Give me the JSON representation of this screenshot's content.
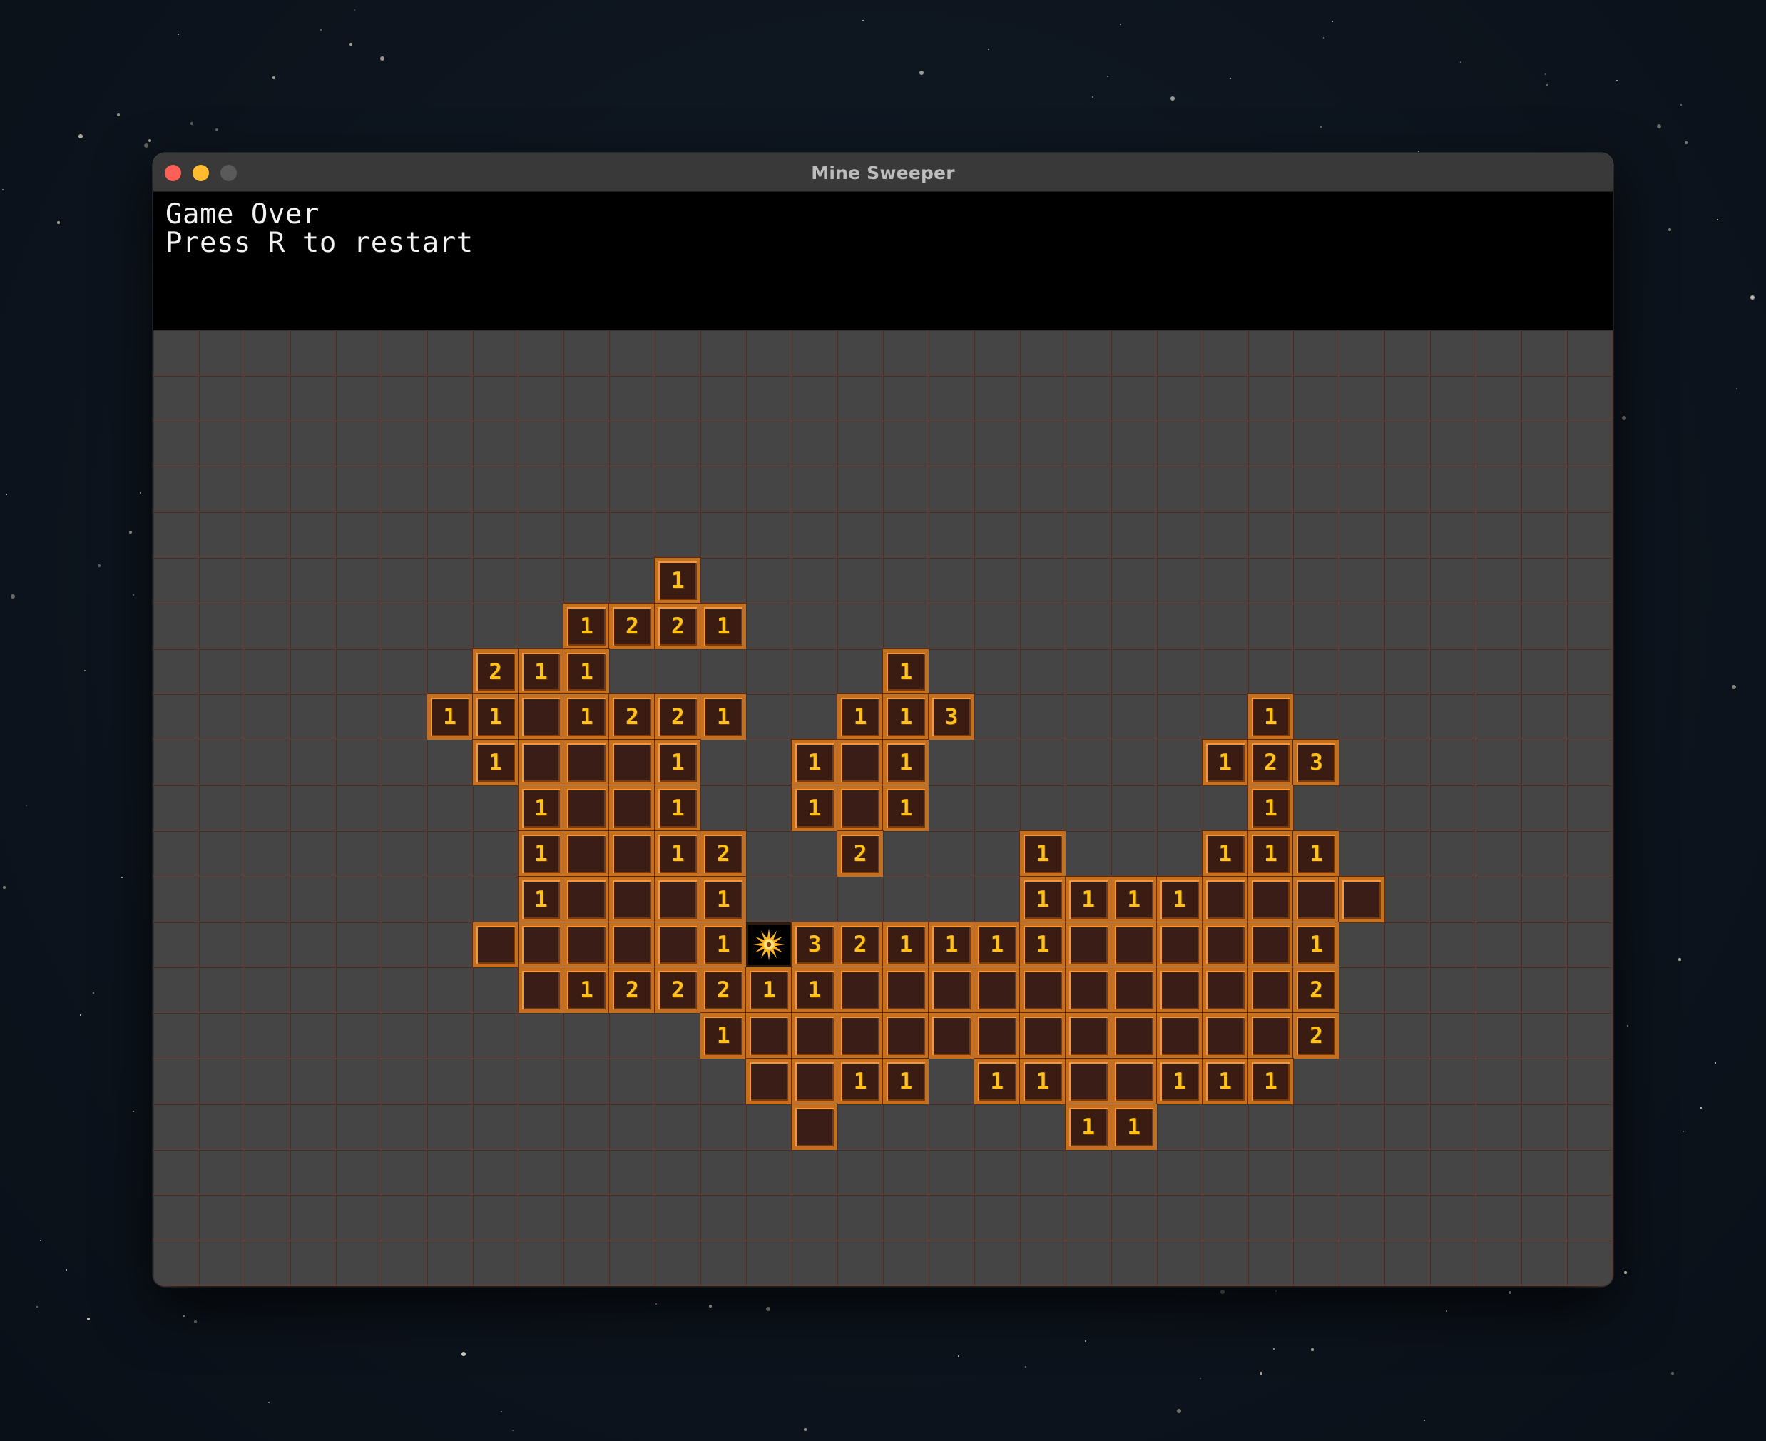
{
  "window": {
    "title": "Mine Sweeper"
  },
  "hud": {
    "line1": "Game Over",
    "line2": "Press R to restart"
  },
  "board": {
    "cols": 32,
    "rows": 21,
    "revealed": [
      {
        "r": 5,
        "c": 11,
        "n": 1
      },
      {
        "r": 6,
        "c": 9,
        "n": 1
      },
      {
        "r": 6,
        "c": 10,
        "n": 2
      },
      {
        "r": 6,
        "c": 11,
        "n": 2
      },
      {
        "r": 6,
        "c": 12,
        "n": 1
      },
      {
        "r": 7,
        "c": 7,
        "n": 2
      },
      {
        "r": 7,
        "c": 8,
        "n": 1
      },
      {
        "r": 7,
        "c": 9,
        "n": 1
      },
      {
        "r": 7,
        "c": 16,
        "n": 1
      },
      {
        "r": 8,
        "c": 6,
        "n": 1
      },
      {
        "r": 8,
        "c": 7,
        "n": 1
      },
      {
        "r": 8,
        "c": 8,
        "n": 0
      },
      {
        "r": 8,
        "c": 9,
        "n": 1
      },
      {
        "r": 8,
        "c": 10,
        "n": 2
      },
      {
        "r": 8,
        "c": 11,
        "n": 2
      },
      {
        "r": 8,
        "c": 12,
        "n": 1
      },
      {
        "r": 8,
        "c": 15,
        "n": 1
      },
      {
        "r": 8,
        "c": 16,
        "n": 1
      },
      {
        "r": 8,
        "c": 17,
        "n": 3
      },
      {
        "r": 8,
        "c": 24,
        "n": 1
      },
      {
        "r": 9,
        "c": 7,
        "n": 1
      },
      {
        "r": 9,
        "c": 8,
        "n": 0
      },
      {
        "r": 9,
        "c": 9,
        "n": 0
      },
      {
        "r": 9,
        "c": 10,
        "n": 0
      },
      {
        "r": 9,
        "c": 11,
        "n": 1
      },
      {
        "r": 9,
        "c": 14,
        "n": 1
      },
      {
        "r": 9,
        "c": 15,
        "n": 0
      },
      {
        "r": 9,
        "c": 16,
        "n": 1
      },
      {
        "r": 9,
        "c": 23,
        "n": 1
      },
      {
        "r": 9,
        "c": 24,
        "n": 2
      },
      {
        "r": 9,
        "c": 25,
        "n": 3
      },
      {
        "r": 10,
        "c": 8,
        "n": 1
      },
      {
        "r": 10,
        "c": 9,
        "n": 0
      },
      {
        "r": 10,
        "c": 10,
        "n": 0
      },
      {
        "r": 10,
        "c": 11,
        "n": 1
      },
      {
        "r": 10,
        "c": 14,
        "n": 1
      },
      {
        "r": 10,
        "c": 15,
        "n": 0
      },
      {
        "r": 10,
        "c": 16,
        "n": 1
      },
      {
        "r": 10,
        "c": 24,
        "n": 1
      },
      {
        "r": 11,
        "c": 8,
        "n": 1
      },
      {
        "r": 11,
        "c": 9,
        "n": 0
      },
      {
        "r": 11,
        "c": 10,
        "n": 0
      },
      {
        "r": 11,
        "c": 11,
        "n": 1
      },
      {
        "r": 11,
        "c": 12,
        "n": 2
      },
      {
        "r": 11,
        "c": 15,
        "n": 2
      },
      {
        "r": 11,
        "c": 19,
        "n": 1
      },
      {
        "r": 11,
        "c": 23,
        "n": 1
      },
      {
        "r": 11,
        "c": 24,
        "n": 1
      },
      {
        "r": 11,
        "c": 25,
        "n": 1
      },
      {
        "r": 12,
        "c": 8,
        "n": 1
      },
      {
        "r": 12,
        "c": 9,
        "n": 0
      },
      {
        "r": 12,
        "c": 10,
        "n": 0
      },
      {
        "r": 12,
        "c": 11,
        "n": 0
      },
      {
        "r": 12,
        "c": 12,
        "n": 1
      },
      {
        "r": 12,
        "c": 19,
        "n": 1
      },
      {
        "r": 12,
        "c": 20,
        "n": 1
      },
      {
        "r": 12,
        "c": 21,
        "n": 1
      },
      {
        "r": 12,
        "c": 22,
        "n": 1
      },
      {
        "r": 12,
        "c": 23,
        "n": 0
      },
      {
        "r": 12,
        "c": 24,
        "n": 0
      },
      {
        "r": 12,
        "c": 25,
        "n": 0
      },
      {
        "r": 12,
        "c": 26,
        "n": 0
      },
      {
        "r": 13,
        "c": 7,
        "n": 0
      },
      {
        "r": 13,
        "c": 8,
        "n": 0
      },
      {
        "r": 13,
        "c": 9,
        "n": 0
      },
      {
        "r": 13,
        "c": 10,
        "n": 0
      },
      {
        "r": 13,
        "c": 11,
        "n": 0
      },
      {
        "r": 13,
        "c": 12,
        "n": 1
      },
      {
        "r": 13,
        "c": 14,
        "n": 3
      },
      {
        "r": 13,
        "c": 15,
        "n": 2
      },
      {
        "r": 13,
        "c": 16,
        "n": 1
      },
      {
        "r": 13,
        "c": 17,
        "n": 1
      },
      {
        "r": 13,
        "c": 18,
        "n": 1
      },
      {
        "r": 13,
        "c": 19,
        "n": 1
      },
      {
        "r": 13,
        "c": 20,
        "n": 0
      },
      {
        "r": 13,
        "c": 21,
        "n": 0
      },
      {
        "r": 13,
        "c": 22,
        "n": 0
      },
      {
        "r": 13,
        "c": 23,
        "n": 0
      },
      {
        "r": 13,
        "c": 24,
        "n": 0
      },
      {
        "r": 13,
        "c": 25,
        "n": 1
      },
      {
        "r": 14,
        "c": 8,
        "n": 0
      },
      {
        "r": 14,
        "c": 9,
        "n": 1
      },
      {
        "r": 14,
        "c": 10,
        "n": 2
      },
      {
        "r": 14,
        "c": 11,
        "n": 2
      },
      {
        "r": 14,
        "c": 12,
        "n": 2
      },
      {
        "r": 14,
        "c": 13,
        "n": 1
      },
      {
        "r": 14,
        "c": 14,
        "n": 1
      },
      {
        "r": 14,
        "c": 15,
        "n": 0
      },
      {
        "r": 14,
        "c": 16,
        "n": 0
      },
      {
        "r": 14,
        "c": 17,
        "n": 0
      },
      {
        "r": 14,
        "c": 18,
        "n": 0
      },
      {
        "r": 14,
        "c": 19,
        "n": 0
      },
      {
        "r": 14,
        "c": 20,
        "n": 0
      },
      {
        "r": 14,
        "c": 21,
        "n": 0
      },
      {
        "r": 14,
        "c": 22,
        "n": 0
      },
      {
        "r": 14,
        "c": 23,
        "n": 0
      },
      {
        "r": 14,
        "c": 24,
        "n": 0
      },
      {
        "r": 14,
        "c": 25,
        "n": 2
      },
      {
        "r": 15,
        "c": 12,
        "n": 1
      },
      {
        "r": 15,
        "c": 13,
        "n": 0
      },
      {
        "r": 15,
        "c": 14,
        "n": 0
      },
      {
        "r": 15,
        "c": 15,
        "n": 0
      },
      {
        "r": 15,
        "c": 16,
        "n": 0
      },
      {
        "r": 15,
        "c": 17,
        "n": 0
      },
      {
        "r": 15,
        "c": 18,
        "n": 0
      },
      {
        "r": 15,
        "c": 19,
        "n": 0
      },
      {
        "r": 15,
        "c": 20,
        "n": 0
      },
      {
        "r": 15,
        "c": 21,
        "n": 0
      },
      {
        "r": 15,
        "c": 22,
        "n": 0
      },
      {
        "r": 15,
        "c": 23,
        "n": 0
      },
      {
        "r": 15,
        "c": 24,
        "n": 0
      },
      {
        "r": 15,
        "c": 25,
        "n": 2
      },
      {
        "r": 16,
        "c": 13,
        "n": 0
      },
      {
        "r": 16,
        "c": 14,
        "n": 0
      },
      {
        "r": 16,
        "c": 15,
        "n": 1
      },
      {
        "r": 16,
        "c": 16,
        "n": 1
      },
      {
        "r": 16,
        "c": 18,
        "n": 1
      },
      {
        "r": 16,
        "c": 19,
        "n": 1
      },
      {
        "r": 16,
        "c": 20,
        "n": 0
      },
      {
        "r": 16,
        "c": 21,
        "n": 0
      },
      {
        "r": 16,
        "c": 22,
        "n": 1
      },
      {
        "r": 16,
        "c": 23,
        "n": 1
      },
      {
        "r": 16,
        "c": 24,
        "n": 1
      },
      {
        "r": 17,
        "c": 14,
        "n": 0
      },
      {
        "r": 17,
        "c": 20,
        "n": 1
      },
      {
        "r": 17,
        "c": 21,
        "n": 1
      }
    ],
    "mine": {
      "r": 13,
      "c": 13
    }
  },
  "colors": {
    "hidden_tile": "#454545",
    "revealed_border": "#c4701e",
    "revealed_fill": "#3a1d16",
    "number": "#ffc21a",
    "mine_bg": "#000000",
    "mine_burst": "#ffb21a"
  }
}
